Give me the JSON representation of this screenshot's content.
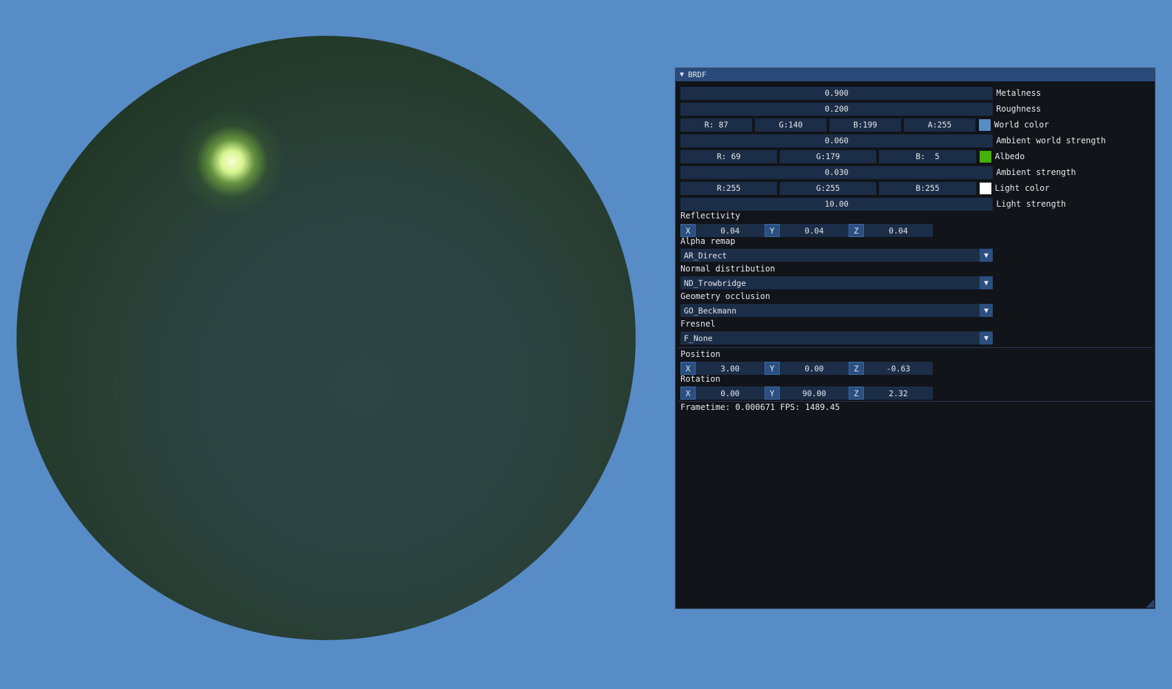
{
  "window": {
    "title": "BRDF",
    "collapse_icon": "triangle-down-icon"
  },
  "colors": {
    "background": "#578cc7",
    "world_color_swatch": "#578cc7",
    "albedo_swatch": "#45b305",
    "light_color_swatch": "#ffffff"
  },
  "sliders": {
    "metalness": {
      "value": "0.900",
      "label": "Metalness"
    },
    "roughness": {
      "value": "0.200",
      "label": "Roughness"
    },
    "ambient_world_strength": {
      "value": "0.060",
      "label": "Ambient world strength"
    },
    "ambient_strength": {
      "value": "0.030",
      "label": "Ambient strength"
    },
    "light_strength": {
      "value": "10.00",
      "label": "Light strength"
    }
  },
  "world_color": {
    "r": "R: 87",
    "g": "G:140",
    "b": "B:199",
    "a": "A:255",
    "label": "World color"
  },
  "albedo": {
    "r": "R: 69",
    "g": "G:179",
    "b": "B:  5",
    "label": "Albedo"
  },
  "light_color": {
    "r": "R:255",
    "g": "G:255",
    "b": "B:255",
    "label": "Light color"
  },
  "reflectivity": {
    "label": "Reflectivity",
    "x": "0.04",
    "y": "0.04",
    "z": "0.04"
  },
  "axes": {
    "x": "X",
    "y": "Y",
    "z": "Z"
  },
  "alpha_remap": {
    "label": "Alpha remap",
    "value": "AR_Direct"
  },
  "normal_distribution": {
    "label": "Normal distribution",
    "value": "ND_Trowbridge"
  },
  "geometry_occlusion": {
    "label": "Geometry occlusion",
    "value": "GO_Beckmann"
  },
  "fresnel": {
    "label": "Fresnel",
    "value": "F_None"
  },
  "position": {
    "label": "Position",
    "x": "3.00",
    "y": "0.00",
    "z": "-0.63"
  },
  "rotation": {
    "label": "Rotation",
    "x": "0.00",
    "y": "90.00",
    "z": "2.32"
  },
  "frame_info": "Frametime: 0.000671 FPS: 1489.45"
}
